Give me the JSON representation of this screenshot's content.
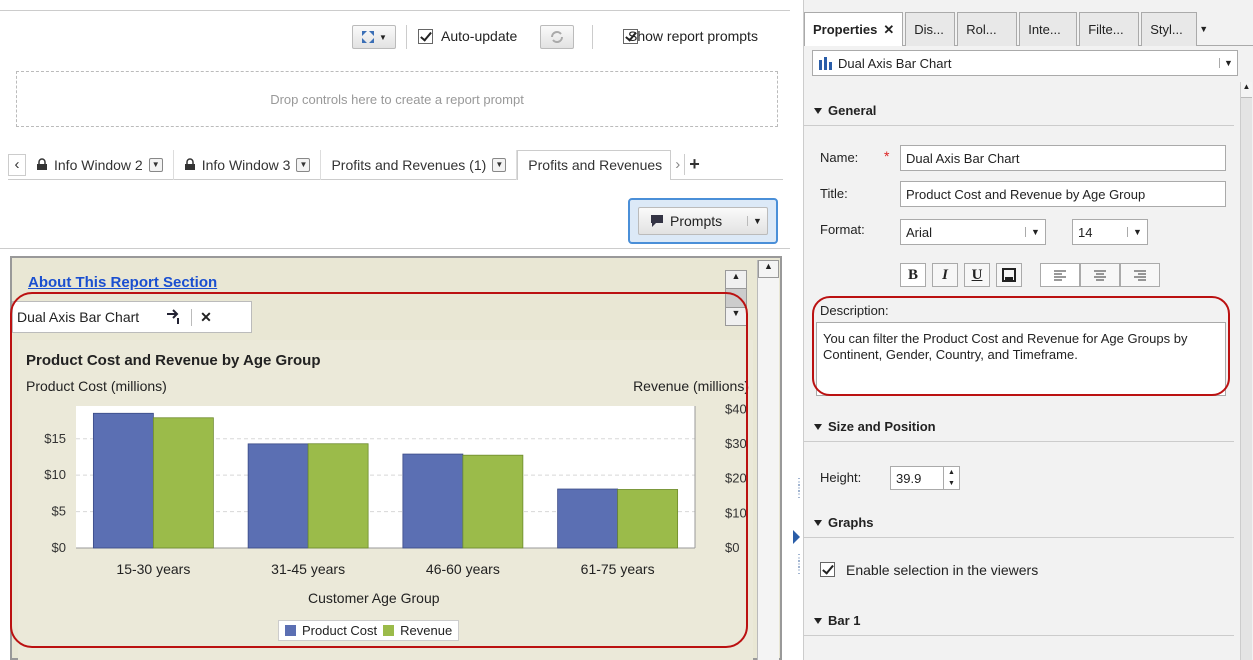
{
  "toolbar": {
    "auto_update_label": "Auto-update",
    "show_prompts_label": "Show report prompts",
    "expand_icon": "expand-icon",
    "refresh_icon": "refresh-icon"
  },
  "prompt_area": {
    "placeholder": "Drop controls here to create a report prompt"
  },
  "tabs": [
    {
      "label": "Info Window 2"
    },
    {
      "label": "Info Window 3"
    },
    {
      "label": "Profits and Revenues (1)"
    },
    {
      "label": "Profits and Revenues"
    }
  ],
  "prompts_button": {
    "label": "Prompts"
  },
  "section": {
    "link": "About This Report Section"
  },
  "object_tab": {
    "label": "Dual Axis Bar Chart"
  },
  "chart_data": {
    "type": "bar",
    "title": "Product Cost and Revenue by Age Group",
    "ylabel": "Product Cost (millions)",
    "y2label": "Revenue (millions)",
    "xlabel": "Customer Age Group",
    "categories": [
      "15-30 years",
      "31-45 years",
      "46-60 years",
      "61-75 years"
    ],
    "series": [
      {
        "name": "Product Cost",
        "axis": "left",
        "color": "#5b6fb3",
        "values": [
          18.5,
          14.3,
          12.9,
          8.1
        ]
      },
      {
        "name": "Revenue",
        "axis": "right",
        "color": "#9bbb4a",
        "values": [
          37.6,
          30.1,
          26.8,
          16.9
        ]
      }
    ],
    "y_ticks": [
      "$0",
      "$5",
      "$10",
      "$15"
    ],
    "y_tick_values": [
      0,
      5,
      10,
      15
    ],
    "ylim": [
      0,
      19.5
    ],
    "y2_ticks": [
      "$0",
      "$10",
      "$20",
      "$30",
      "$40"
    ],
    "y2_tick_values": [
      0,
      10,
      20,
      30,
      40
    ],
    "y2lim": [
      0,
      41
    ],
    "grid": true,
    "legend_position": "bottom"
  },
  "properties": {
    "tabs": [
      {
        "label": "Properties"
      },
      {
        "label": "Dis..."
      },
      {
        "label": "Rol..."
      },
      {
        "label": "Inte..."
      },
      {
        "label": "Filte..."
      },
      {
        "label": "Styl..."
      }
    ],
    "object_select": "Dual Axis Bar Chart",
    "general": "General",
    "name_label": "Name:",
    "name_value": "Dual Axis Bar Chart",
    "title_label": "Title:",
    "title_value": "Product Cost and Revenue by Age Group",
    "format_label": "Format:",
    "font_value": "Arial",
    "size_value": "14",
    "bold": "B",
    "italic": "I",
    "underline": "U",
    "description_label": "Description:",
    "description_value": "You can filter the Product Cost and Revenue for Age Groups by Continent, Gender, Country, and Timeframe.",
    "size_position": "Size and Position",
    "height_label": "Height:",
    "height_value": "39.9",
    "graphs": "Graphs",
    "enable_selection": "Enable selection in the viewers",
    "bar1": "Bar 1"
  }
}
